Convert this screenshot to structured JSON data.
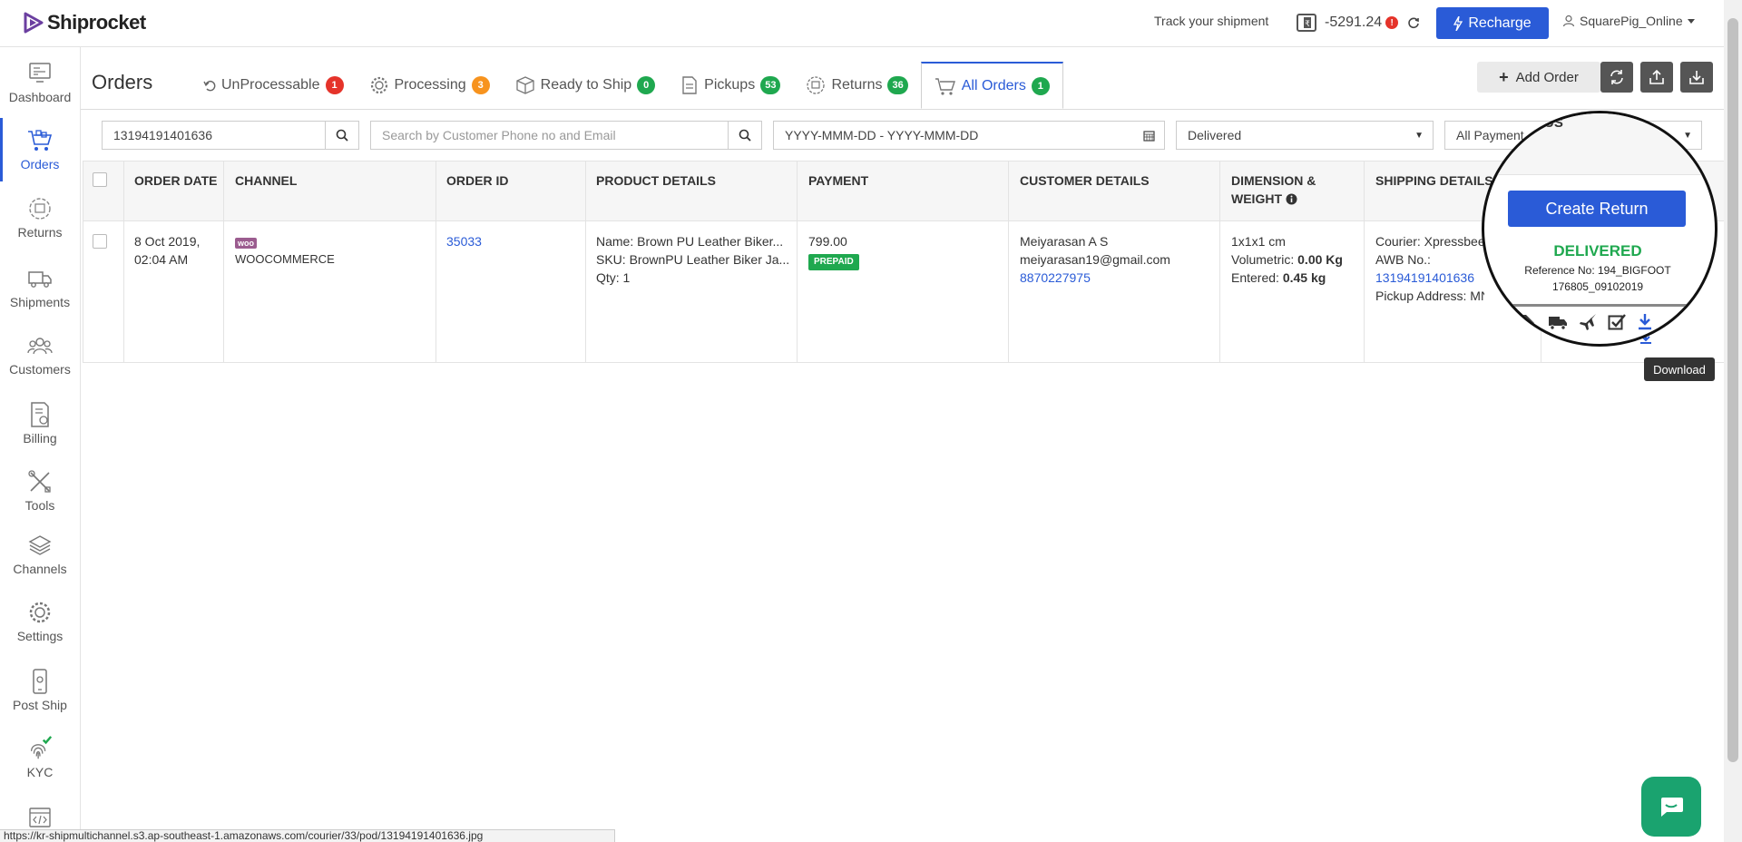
{
  "app": {
    "logo_text": "Shiprocket"
  },
  "topbar": {
    "track_label": "Track your shipment",
    "wallet_amount": "-5291.24",
    "alert_mark": "!",
    "recharge_label": "Recharge",
    "user_name": "SquarePig_Online"
  },
  "sidebar": {
    "items": [
      {
        "label": "Dashboard",
        "icon": "dashboard-icon"
      },
      {
        "label": "Orders",
        "icon": "cart-icon",
        "active": true
      },
      {
        "label": "Returns",
        "icon": "returns-icon"
      },
      {
        "label": "Shipments",
        "icon": "truck-icon"
      },
      {
        "label": "Customers",
        "icon": "customers-icon"
      },
      {
        "label": "Billing",
        "icon": "billing-icon"
      },
      {
        "label": "Tools",
        "icon": "tools-icon"
      },
      {
        "label": "Channels",
        "icon": "layers-icon"
      },
      {
        "label": "Settings",
        "icon": "gear-icon"
      },
      {
        "label": "Post Ship",
        "icon": "phone-icon"
      },
      {
        "label": "KYC",
        "icon": "fingerprint-icon"
      }
    ]
  },
  "header": {
    "title": "Orders",
    "tabs": [
      {
        "label": "UnProcessable",
        "count": "1",
        "color": "#e5332a"
      },
      {
        "label": "Processing",
        "count": "3",
        "color": "#f7931e"
      },
      {
        "label": "Ready to Ship",
        "count": "0",
        "color": "#1fa84f"
      },
      {
        "label": "Pickups",
        "count": "53",
        "color": "#1fa84f"
      },
      {
        "label": "Returns",
        "count": "36",
        "color": "#1fa84f"
      },
      {
        "label": "All Orders",
        "count": "1",
        "color": "#1fa84f",
        "active": true
      }
    ],
    "add_order_label": "Add Order"
  },
  "filters": {
    "awb_value": "13194191401636",
    "customer_placeholder": "Search by Customer Phone no and Email",
    "date_placeholder": "YYYY-MMM-DD - YYYY-MMM-DD",
    "status_value": "Delivered",
    "payment_value": "All Payment"
  },
  "table": {
    "headers": {
      "order_date": "ORDER DATE",
      "channel": "CHANNEL",
      "order_id": "ORDER ID",
      "product": "PRODUCT DETAILS",
      "payment": "PAYMENT",
      "customer": "CUSTOMER DETAILS",
      "dimension_1": "DIMENSION &",
      "dimension_2": "WEIGHT",
      "shipping": "SHIPPING DETAILS"
    },
    "row": {
      "date_1": "8 Oct 2019,",
      "date_2": "02:04 AM",
      "channel_logo": "woo",
      "channel_name": "WOOCOMMERCE",
      "order_id": "35033",
      "product_name": "Name: Brown PU Leather Biker...",
      "product_sku": "SKU: BrownPU Leather Biker Ja...",
      "product_qty": "Qty: 1",
      "amount": "799.00",
      "payment_mode": "PREPAID",
      "customer_name": "Meiyarasan A S",
      "customer_email": "meiyarasan19@gmail.com",
      "customer_phone": "8870227975",
      "dimension": "1x1x1 cm",
      "volumetric_label": "Volumetric:",
      "volumetric_value": "0.00 Kg",
      "entered_label": "Entered:",
      "entered_value": "0.45 kg",
      "courier": "Courier: Xpressbee",
      "awb_label": "AWB No.:",
      "awb_value": "13194191401636",
      "pickup": "Pickup Address: MN"
    }
  },
  "magnifier": {
    "partial_header": "US",
    "create_return_label": "Create Return",
    "status": "DELIVERED",
    "ref_line_1": "Reference No: 194_BIGFOOT",
    "ref_line_2": "176805_09102019"
  },
  "tooltip": "Download",
  "status_url": "https://kr-shipmultichannel.s3.ap-southeast-1.amazonaws.com/courier/33/pod/13194191401636.jpg"
}
